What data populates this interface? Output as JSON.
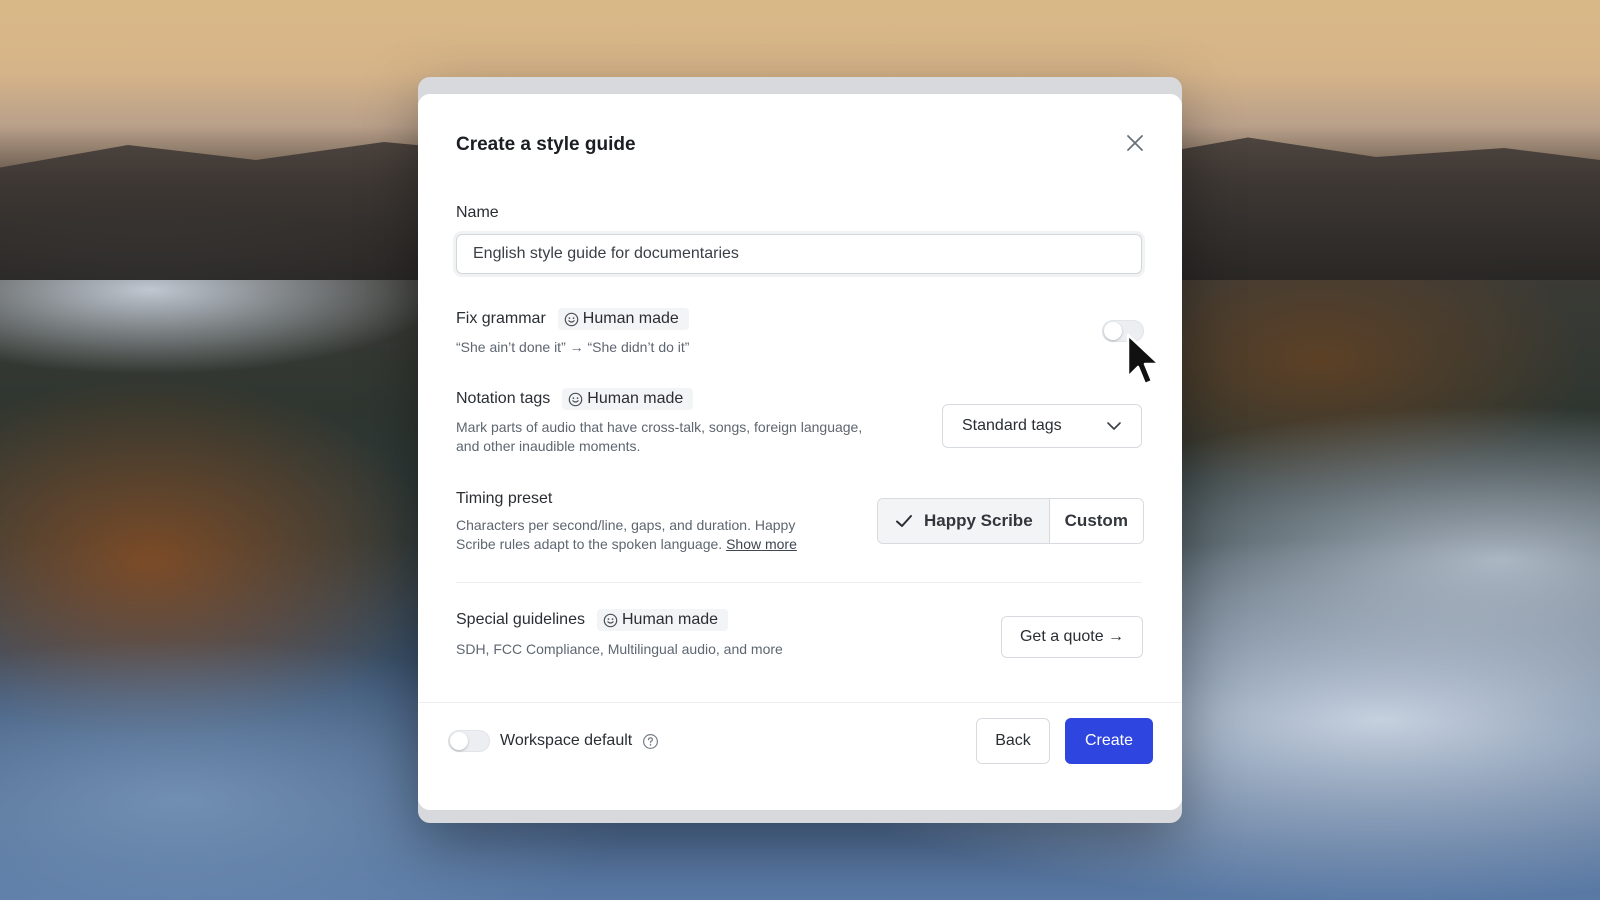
{
  "dialog": {
    "title": "Create a style guide",
    "close_icon": "close-icon"
  },
  "name_field": {
    "label": "Name",
    "value": "English style guide for documentaries"
  },
  "fix_grammar": {
    "label": "Fix grammar",
    "badge": "Human made",
    "example": "“She ain’t done it” → “She didn’t do it”",
    "enabled": false
  },
  "notation_tags": {
    "label": "Notation tags",
    "badge": "Human made",
    "description_line1": "Mark parts of audio that have cross-talk, songs, foreign language,",
    "description_line2": "and other inaudible moments.",
    "selected": "Standard tags"
  },
  "timing_preset": {
    "label": "Timing preset",
    "description_line1": "Characters per second/line, gaps, and duration. Happy",
    "description_line2": "Scribe rules adapt to the spoken language.",
    "show_more": "Show more",
    "options": [
      "Happy Scribe",
      "Custom"
    ],
    "selected": "Happy Scribe"
  },
  "special_guidelines": {
    "label": "Special guidelines",
    "badge": "Human made",
    "description": "SDH, FCC Compliance, Multilingual audio, and more",
    "button": "Get a quote →"
  },
  "footer": {
    "workspace_default_label": "Workspace default",
    "workspace_default_enabled": false,
    "back": "Back",
    "create": "Create"
  },
  "colors": {
    "primary": "#2f45e0",
    "modal_bg": "#ffffff",
    "badge_bg": "#f3f4f6"
  }
}
